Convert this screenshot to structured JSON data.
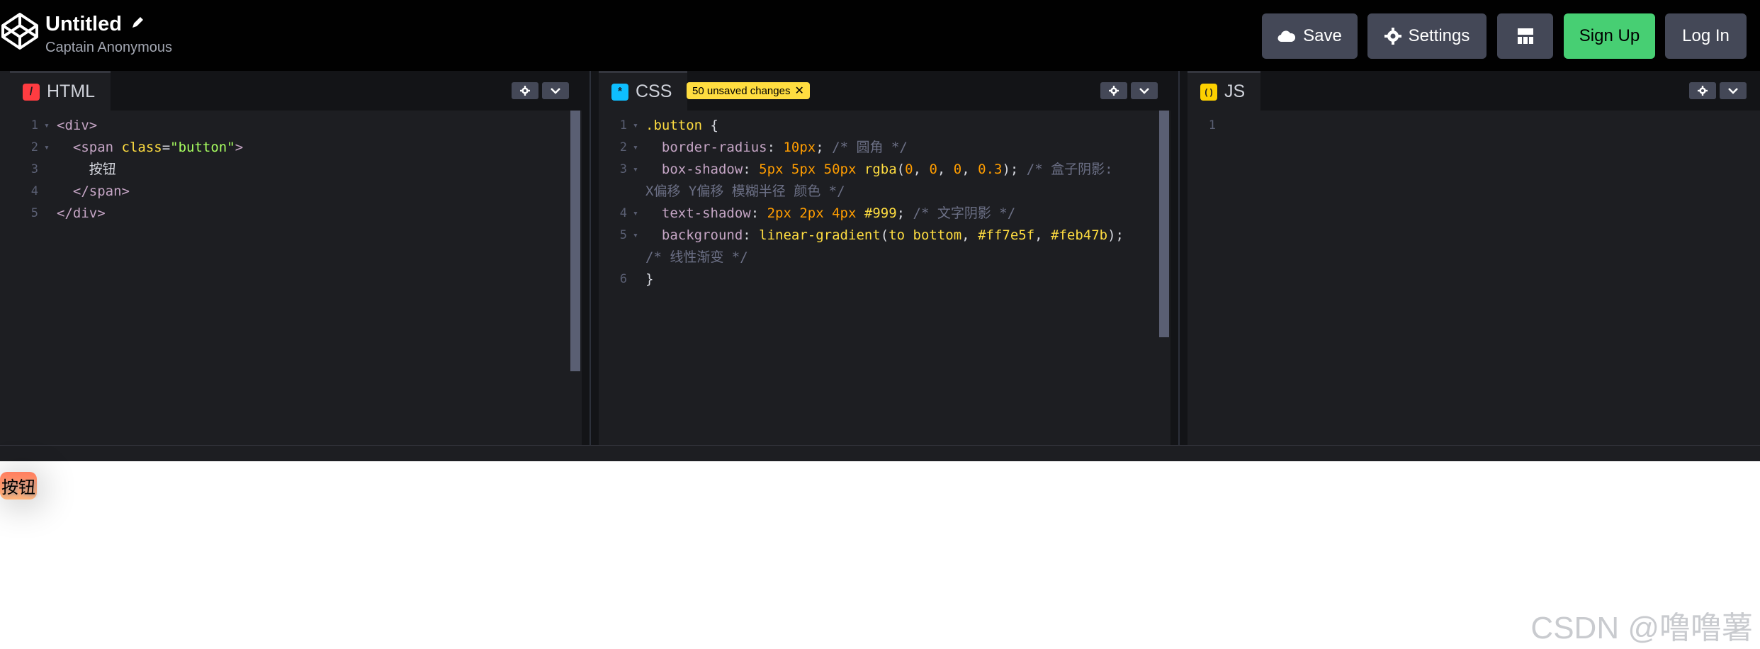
{
  "header": {
    "title": "Untitled",
    "author": "Captain Anonymous",
    "save_label": "Save",
    "settings_label": "Settings",
    "signup_label": "Sign Up",
    "login_label": "Log In"
  },
  "panels": {
    "html": {
      "label": "HTML",
      "icon_glyph": "/",
      "lines": [
        {
          "n": "1",
          "segs": [
            {
              "t": "<div>",
              "c": "t-tag"
            }
          ]
        },
        {
          "n": "2",
          "segs": [
            {
              "t": "  <span ",
              "c": "t-tag"
            },
            {
              "t": "class",
              "c": "t-att"
            },
            {
              "t": "=",
              "c": ""
            },
            {
              "t": "\"button\"",
              "c": "t-str"
            },
            {
              "t": ">",
              "c": "t-tag"
            }
          ]
        },
        {
          "n": "3",
          "segs": [
            {
              "t": "    按钮",
              "c": ""
            }
          ]
        },
        {
          "n": "4",
          "segs": [
            {
              "t": "  </span>",
              "c": "t-tag"
            }
          ]
        },
        {
          "n": "5",
          "segs": [
            {
              "t": "</div>",
              "c": "t-tag"
            }
          ]
        }
      ]
    },
    "css": {
      "label": "CSS",
      "icon_glyph": "*",
      "badge": "50 unsaved changes",
      "lines": [
        {
          "n": "1",
          "segs": [
            {
              "t": ".button ",
              "c": "t-sel"
            },
            {
              "t": "{",
              "c": ""
            }
          ]
        },
        {
          "n": "2",
          "segs": [
            {
              "t": "  border-radius",
              "c": "t-prop"
            },
            {
              "t": ": ",
              "c": ""
            },
            {
              "t": "10px",
              "c": "t-num"
            },
            {
              "t": "; ",
              "c": ""
            },
            {
              "t": "/* 圆角 */",
              "c": "t-com"
            }
          ]
        },
        {
          "n": "3",
          "segs": [
            {
              "t": "  box-shadow",
              "c": "t-prop"
            },
            {
              "t": ": ",
              "c": ""
            },
            {
              "t": "5px 5px 50px ",
              "c": "t-num"
            },
            {
              "t": "rgba",
              "c": "t-fn"
            },
            {
              "t": "(",
              "c": ""
            },
            {
              "t": "0",
              "c": "t-num"
            },
            {
              "t": ", ",
              "c": ""
            },
            {
              "t": "0",
              "c": "t-num"
            },
            {
              "t": ", ",
              "c": ""
            },
            {
              "t": "0",
              "c": "t-num"
            },
            {
              "t": ", ",
              "c": ""
            },
            {
              "t": "0.3",
              "c": "t-num"
            },
            {
              "t": "); ",
              "c": ""
            },
            {
              "t": "/* 盒子阴影:",
              "c": "t-com"
            }
          ]
        },
        {
          "n": "",
          "segs": [
            {
              "t": "X偏移 Y偏移 模糊半径 颜色 */",
              "c": "t-com"
            }
          ]
        },
        {
          "n": "4",
          "segs": [
            {
              "t": "  text-shadow",
              "c": "t-prop"
            },
            {
              "t": ": ",
              "c": ""
            },
            {
              "t": "2px 2px 4px ",
              "c": "t-num"
            },
            {
              "t": "#999",
              "c": "t-fn"
            },
            {
              "t": "; ",
              "c": ""
            },
            {
              "t": "/* 文字阴影 */",
              "c": "t-com"
            }
          ]
        },
        {
          "n": "5",
          "segs": [
            {
              "t": "  background",
              "c": "t-prop"
            },
            {
              "t": ": ",
              "c": ""
            },
            {
              "t": "linear-gradient",
              "c": "t-fn"
            },
            {
              "t": "(",
              "c": ""
            },
            {
              "t": "to bottom",
              "c": "t-fn"
            },
            {
              "t": ", ",
              "c": ""
            },
            {
              "t": "#ff7e5f",
              "c": "t-fn"
            },
            {
              "t": ", ",
              "c": ""
            },
            {
              "t": "#feb47b",
              "c": "t-fn"
            },
            {
              "t": ");",
              "c": ""
            }
          ]
        },
        {
          "n": "",
          "segs": [
            {
              "t": "/* 线性渐变 */",
              "c": "t-com"
            }
          ]
        },
        {
          "n": "6",
          "segs": [
            {
              "t": "}",
              "c": ""
            }
          ]
        }
      ]
    },
    "js": {
      "label": "JS",
      "icon_glyph": "( )",
      "lines": [
        {
          "n": "1",
          "segs": []
        }
      ]
    }
  },
  "preview": {
    "button_text": "按钮"
  },
  "watermark": "CSDN @噜噜薯",
  "colors": {
    "html_icon": "#ff3c41",
    "css_icon": "#0ebeff",
    "js_icon": "#fcd000",
    "signup": "#47cf73"
  }
}
